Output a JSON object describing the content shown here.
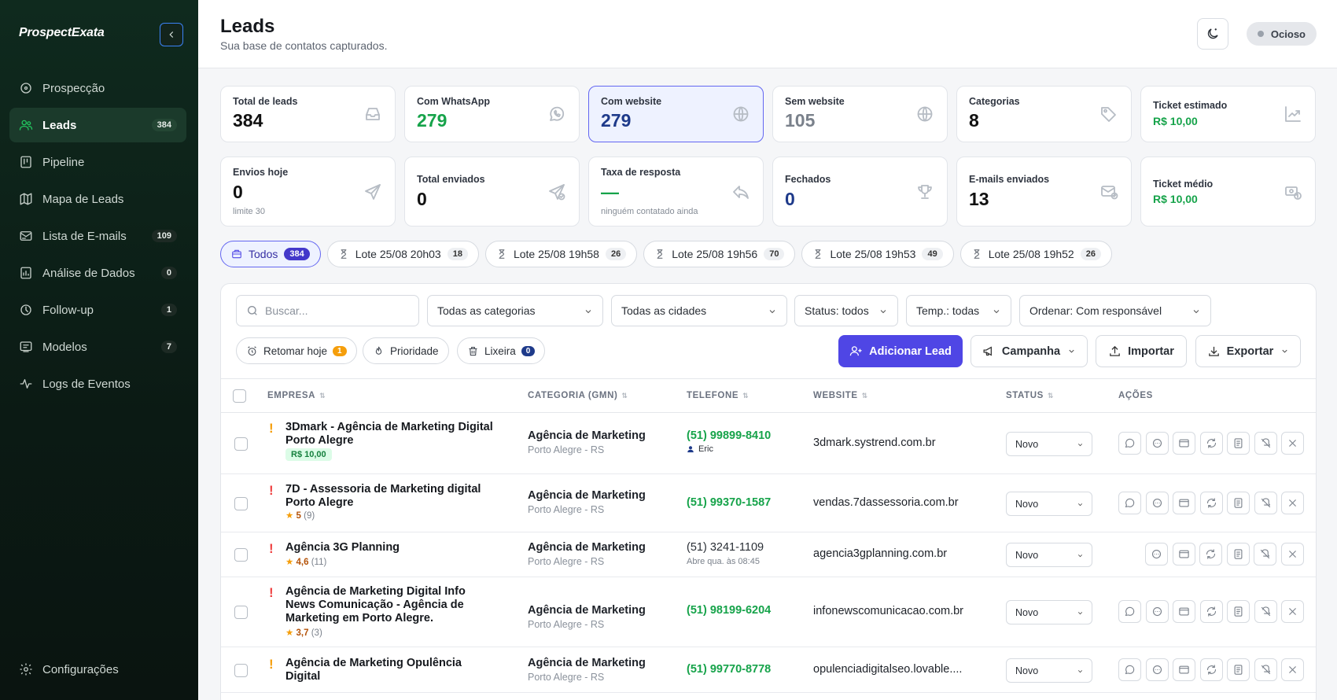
{
  "app": {
    "logo": "ProspectExata"
  },
  "sidebar": {
    "items": [
      {
        "label": "Prospecção",
        "icon": "target-icon",
        "count": null,
        "active": false
      },
      {
        "label": "Leads",
        "icon": "users-icon",
        "count": "384",
        "active": true
      },
      {
        "label": "Pipeline",
        "icon": "kanban-icon",
        "count": null,
        "active": false
      },
      {
        "label": "Mapa de Leads",
        "icon": "map-icon",
        "count": null,
        "active": false
      },
      {
        "label": "Lista de E-mails",
        "icon": "mail-list-icon",
        "count": "109",
        "active": false
      },
      {
        "label": "Análise de Dados",
        "icon": "chart-icon",
        "count": "0",
        "active": false
      },
      {
        "label": "Follow-up",
        "icon": "clock-icon",
        "count": "1",
        "active": false
      },
      {
        "label": "Modelos",
        "icon": "template-icon",
        "count": "7",
        "active": false
      },
      {
        "label": "Logs de Eventos",
        "icon": "activity-icon",
        "count": null,
        "active": false
      }
    ],
    "footer": {
      "label": "Configurações",
      "icon": "settings-icon"
    }
  },
  "header": {
    "title": "Leads",
    "subtitle": "Sua base de contatos capturados.",
    "status": "Ocioso"
  },
  "stats_row1": [
    {
      "label": "Total de leads",
      "value": "384",
      "icon": "inbox-icon",
      "color": "#111111"
    },
    {
      "label": "Com WhatsApp",
      "value": "279",
      "icon": "whatsapp-icon",
      "color": "#16a34a"
    },
    {
      "label": "Com website",
      "value": "279",
      "icon": "globe-icon",
      "color": "#1e3a8a"
    },
    {
      "label": "Sem website",
      "value": "105",
      "icon": "globe-icon",
      "color": "#7a818b"
    },
    {
      "label": "Categorias",
      "value": "8",
      "icon": "tags-icon",
      "color": "#111111"
    },
    {
      "label": "Ticket estimado",
      "value": "R$ 10,00",
      "icon": "trend-icon",
      "color": "#16a34a"
    }
  ],
  "stats_row2": [
    {
      "label": "Envios hoje",
      "value": "0",
      "sub": "limite 30",
      "icon": "send-icon"
    },
    {
      "label": "Total enviados",
      "value": "0",
      "sub": "",
      "icon": "send-check-icon"
    },
    {
      "label": "Taxa de resposta",
      "value": "—",
      "sub": "ninguém contatado ainda",
      "icon": "reply-icon"
    },
    {
      "label": "Fechados",
      "value": "0",
      "sub": "",
      "icon": "trophy-icon"
    },
    {
      "label": "E-mails enviados",
      "value": "13",
      "sub": "",
      "icon": "mail-check-icon"
    },
    {
      "label": "Ticket médio",
      "value": "R$ 10,00",
      "sub": "",
      "icon": "money-icon"
    }
  ],
  "batches": [
    {
      "label": "Todos",
      "count": "384",
      "active": true
    },
    {
      "label": "Lote 25/08 20h03",
      "count": "18",
      "active": false
    },
    {
      "label": "Lote 25/08 19h58",
      "count": "26",
      "active": false
    },
    {
      "label": "Lote 25/08 19h56",
      "count": "70",
      "active": false
    },
    {
      "label": "Lote 25/08 19h53",
      "count": "49",
      "active": false
    },
    {
      "label": "Lote 25/08 19h52",
      "count": "26",
      "active": false
    }
  ],
  "filters": {
    "search_placeholder": "Buscar...",
    "categories": "Todas as categorias",
    "cities": "Todas as cidades",
    "status": "Status: todos",
    "temp": "Temp.: todas",
    "order": "Ordenar: Com responsável",
    "retomar": "Retomar hoje",
    "retomar_count": "1",
    "prioridade": "Prioridade",
    "lixeira": "Lixeira",
    "lixeira_count": "0"
  },
  "actions": {
    "add": "Adicionar Lead",
    "campaign": "Campanha",
    "import": "Importar",
    "export": "Exportar"
  },
  "table": {
    "columns": [
      "EMPRESA",
      "CATEGORIA (GMN)",
      "TELEFONE",
      "WEBSITE",
      "STATUS",
      "AÇÕES"
    ],
    "rows": [
      {
        "name": "3Dmark - Agência de Marketing Digital Porto Alegre",
        "priority": "yellow",
        "tag": "R$ 10,00",
        "rating": null,
        "reviews": null,
        "category": "Agência de Marketing",
        "city": "Porto Alegre - RS",
        "phone": "(51) 99899-8410",
        "phone_whatsapp": true,
        "phone_sub": "Eric",
        "website": "3dmark.systrend.com.br",
        "status": "Novo"
      },
      {
        "name": "7D - Assessoria de Marketing digital Porto Alegre",
        "priority": "red",
        "tag": null,
        "rating": "5",
        "reviews": "(9)",
        "category": "Agência de Marketing",
        "city": "Porto Alegre - RS",
        "phone": "(51) 99370-1587",
        "phone_whatsapp": true,
        "phone_sub": null,
        "website": "vendas.7dassessoria.com.br",
        "status": "Novo"
      },
      {
        "name": "Agência 3G Planning",
        "priority": "red",
        "tag": null,
        "rating": "4,6",
        "reviews": "(11)",
        "category": "Agência de Marketing",
        "city": "Porto Alegre - RS",
        "phone": "(51) 3241-1109",
        "phone_whatsapp": false,
        "phone_sub": "Abre qua. às 08:45",
        "website": "agencia3gplanning.com.br",
        "status": "Novo"
      },
      {
        "name": "Agência de Marketing Digital Info News Comunicação - Agência de Marketing em Porto Alegre.",
        "priority": "red",
        "tag": null,
        "rating": "3,7",
        "reviews": "(3)",
        "category": "Agência de Marketing",
        "city": "Porto Alegre - RS",
        "phone": "(51) 98199-6204",
        "phone_whatsapp": true,
        "phone_sub": null,
        "website": "infonewscomunicacao.com.br",
        "status": "Novo"
      },
      {
        "name": "Agência de Marketing Opulência Digital",
        "priority": "yellow",
        "tag": null,
        "rating": null,
        "reviews": null,
        "category": "Agência de Marketing",
        "city": "Porto Alegre - RS",
        "phone": "(51) 99770-8778",
        "phone_whatsapp": true,
        "phone_sub": null,
        "website": "opulenciadigitalseo.lovable....",
        "status": "Novo"
      }
    ]
  },
  "colors": {
    "brand_green": "#16a34a",
    "accent": "#4f46e5",
    "sidebar_bg": "#0f2a1e",
    "priority_yellow": "#f59e0b",
    "priority_red": "#ef4444"
  }
}
